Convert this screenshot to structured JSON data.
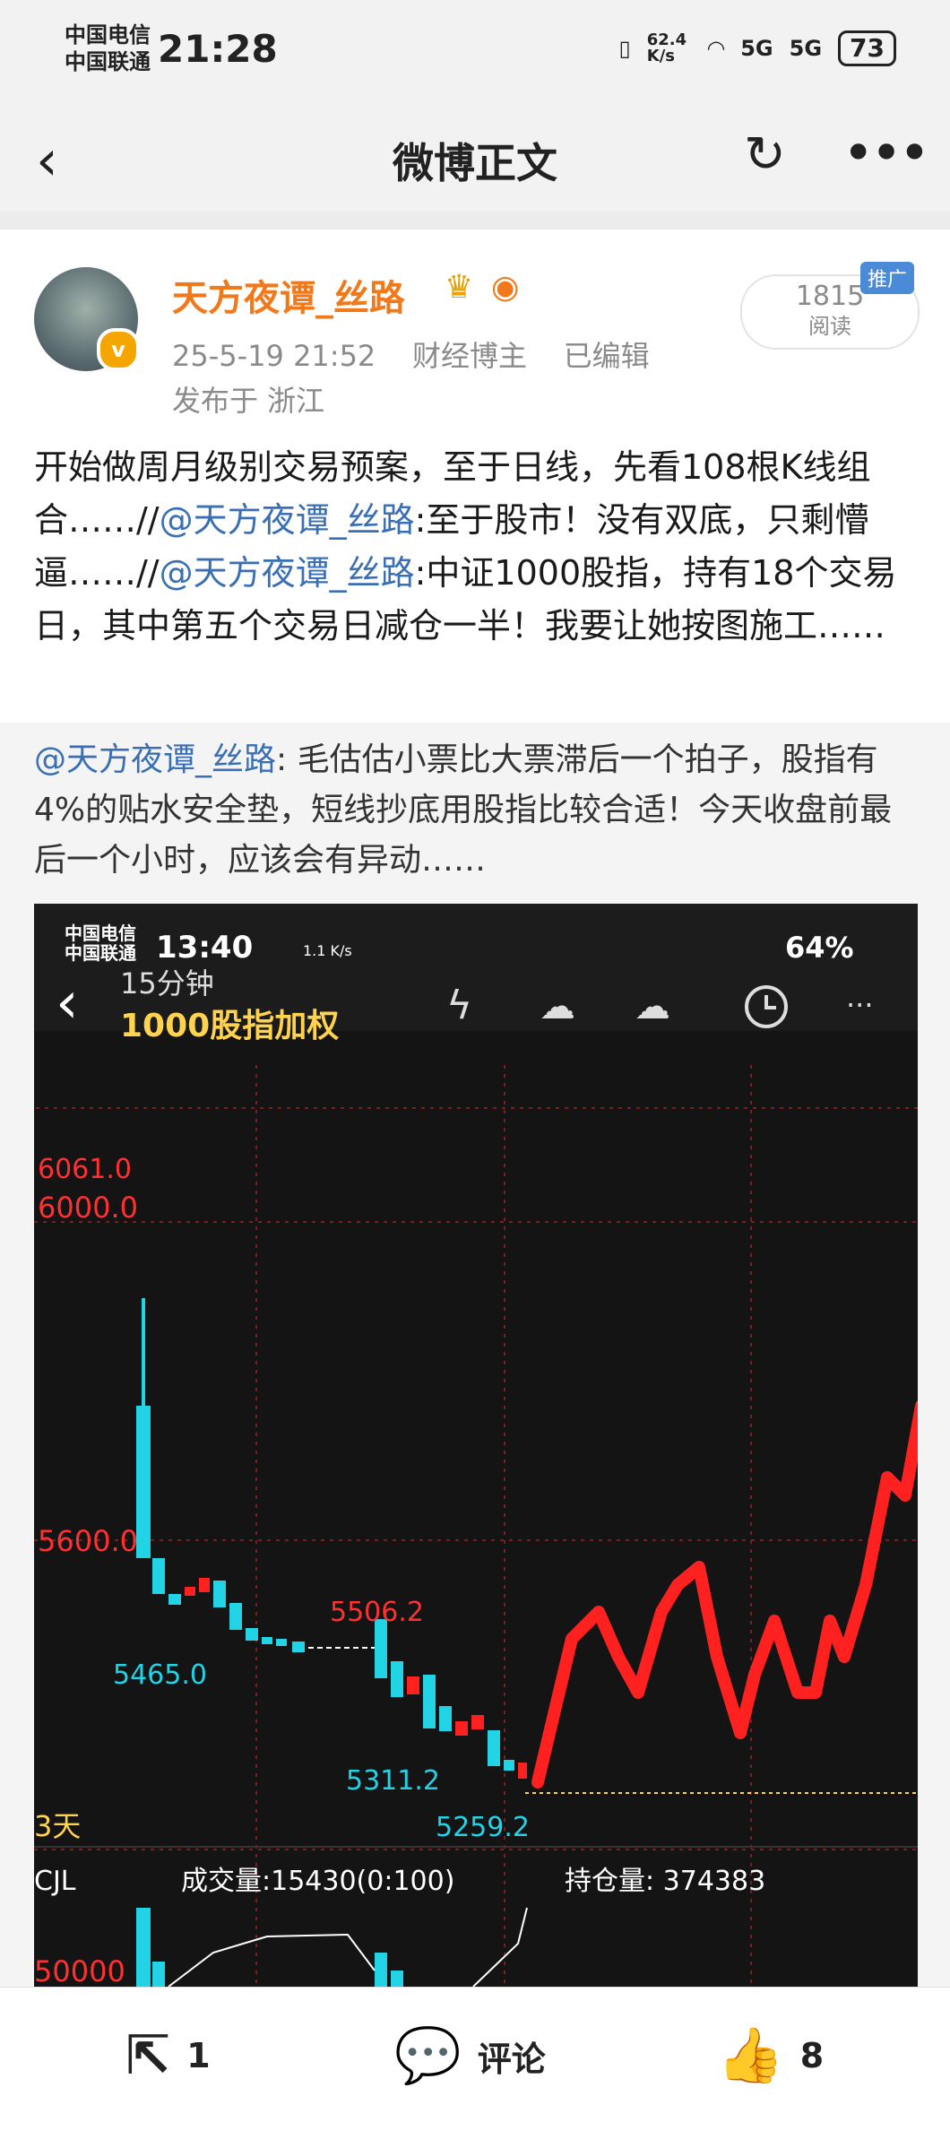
{
  "status_bar": {
    "carrier1": "中国电信",
    "carrier2": "中国联通",
    "time": "21:28",
    "net_speed": "62.4 K/s",
    "signal1": "5G",
    "signal2": "5G",
    "battery": "73"
  },
  "nav": {
    "title": "微博正文"
  },
  "post": {
    "username": "天方夜谭_丝路",
    "datetime": "25-5-19 21:52",
    "role": "财经博主",
    "edited": "已编辑",
    "location": "发布于 浙江",
    "read_count": "1815",
    "read_label": "阅读",
    "promo_tag": "推广",
    "text_part1": "开始做周月级别交易预案，至于日线，先看108根K线组合……//",
    "mention1": "@天方夜谭_丝路",
    "text_part2": ":至于股市！没有双底，只剩懵逼……//",
    "mention2": "@天方夜谭_丝路",
    "text_part3": ":中证1000股指，持有18个交易日，其中第五个交易日减仓一半！我要让她按图施工……"
  },
  "quote": {
    "mention": "@天方夜谭_丝路",
    "text": ": 毛估估小票比大票滞后一个拍子，股指有4%的贴水安全垫，短线抄底用股指比较合适！今天收盘前最后一个小时，应该会有异动……"
  },
  "embedded_screenshot": {
    "carrier1": "中国电信",
    "carrier2": "中国联通",
    "time": "13:40",
    "net_speed": "1.1 K/s",
    "battery": "64%",
    "period": "15分钟",
    "instrument": "1000股指加权",
    "price_labels": [
      "6061.0",
      "6000.0",
      "5600.0"
    ],
    "annotations": [
      "5506.2",
      "5465.0",
      "5311.2",
      "5259.2"
    ],
    "days_label": "3天",
    "indicator_label": "CJL",
    "volume_text": "成交量:15430(0:100)",
    "open_interest_text": "持仓量: 374383",
    "volume_axis_label": "50000",
    "colors": {
      "up": "#ff2020",
      "down": "#22d3e6",
      "bg": "#141414",
      "label": "#ffd34d"
    }
  },
  "bottom_bar": {
    "share_count": "1",
    "comment_label": "评论",
    "like_count": "8"
  }
}
